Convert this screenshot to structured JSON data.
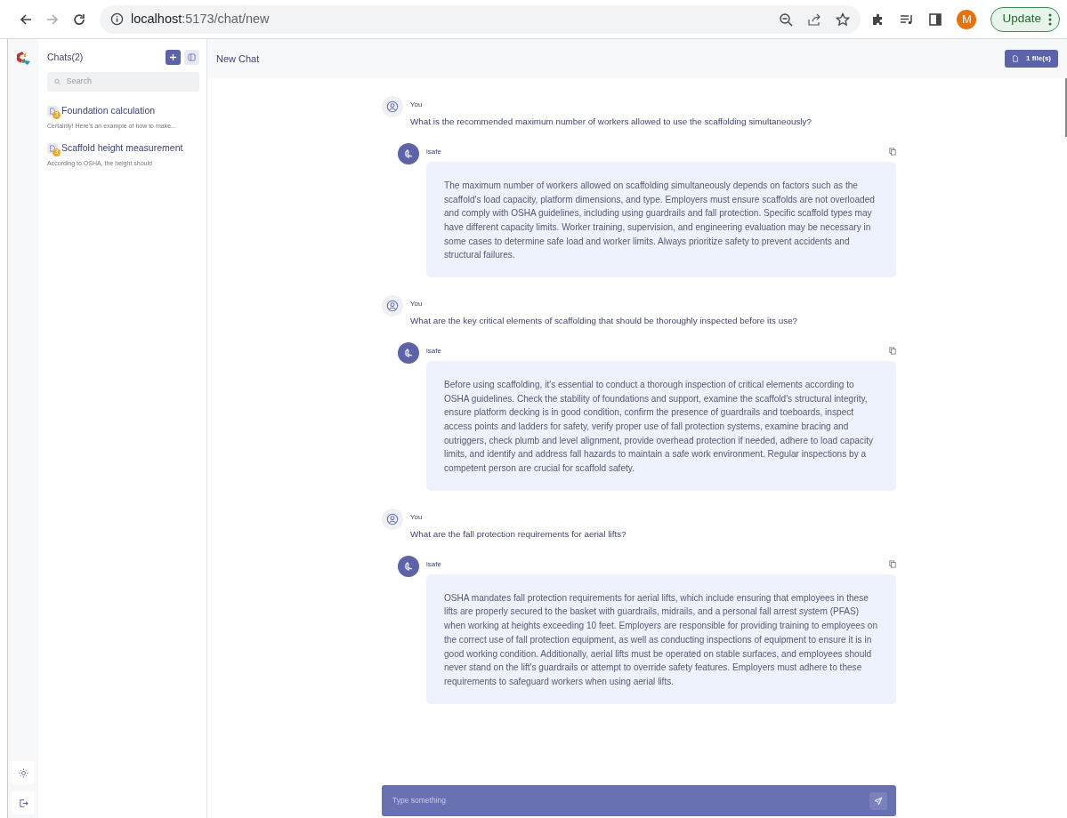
{
  "browser": {
    "url_host": "localhost",
    "url_rest": ":5173/chat/new",
    "profile_initial": "M",
    "update_label": "Update"
  },
  "sidebar": {
    "title": "Chats(2)",
    "search_placeholder": "Search",
    "chats": [
      {
        "title": "Foundation calculation",
        "preview": "Certainly! Here's an example of how to make...",
        "badge": "3"
      },
      {
        "title": "Scaffold height measurement",
        "preview": "According to OSHA, the height should",
        "badge": "3"
      }
    ]
  },
  "header": {
    "title": "New Chat",
    "files_label": "1 file(s)"
  },
  "messages": [
    {
      "kind": "user",
      "author": "You",
      "text": "What is the recommended maximum number of workers allowed to use the scaffolding simultaneously?"
    },
    {
      "kind": "bot",
      "author": "isafe",
      "text": "The maximum number of workers allowed on scaffolding simultaneously depends on factors such as the scaffold's load capacity, platform dimensions, and type. Employers must ensure scaffolds are not overloaded and comply with OSHA guidelines, including using guardrails and fall protection. Specific scaffold types may have different capacity limits. Worker training, supervision, and engineering evaluation may be necessary in some cases to determine safe load and worker limits. Always prioritize safety to prevent accidents and structural failures."
    },
    {
      "kind": "user",
      "author": "You",
      "text": "What are the key critical elements of scaffolding that should be thoroughly inspected before its use?"
    },
    {
      "kind": "bot",
      "author": "isafe",
      "text": "Before using scaffolding, it's essential to conduct a thorough inspection of critical elements according to OSHA guidelines. Check the stability of foundations and support, examine the scaffold's structural integrity, ensure platform decking is in good condition, confirm the presence of guardrails and toeboards, inspect access points and ladders for safety, verify proper use of fall protection systems, examine bracing and outriggers, check plumb and level alignment, provide overhead protection if needed, adhere to load capacity limits, and identify and address fall hazards to maintain a safe work environment. Regular inspections by a competent person are crucial for scaffold safety."
    },
    {
      "kind": "user",
      "author": "You",
      "text": "What are the fall protection requirements for aerial lifts?"
    },
    {
      "kind": "bot",
      "author": "isafe",
      "text": "OSHA mandates fall protection requirements for aerial lifts, which include ensuring that employees in these lifts are properly secured to the basket with guardrails, midrails, and a personal fall arrest system (PFAS) when working at heights exceeding 10 feet. Employers are responsible for providing training to employees on the correct use of fall protection equipment, as well as conducting inspections of equipment to ensure it is in good working condition. Additionally, aerial lifts must be operated on stable surfaces, and employees should never stand on the lift's guardrails or attempt to override safety features. Employers must adhere to these requirements to safeguard workers when using aerial lifts."
    }
  ],
  "composer": {
    "placeholder": "Type something"
  }
}
